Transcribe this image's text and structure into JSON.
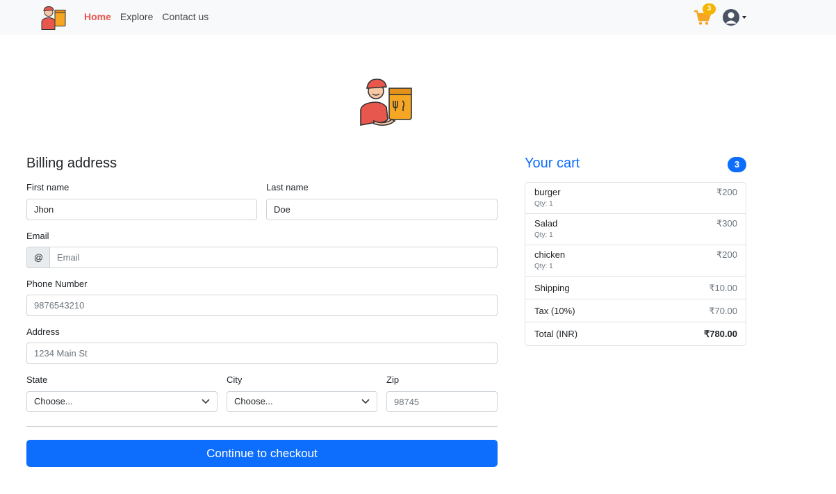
{
  "nav": {
    "logo_icon": "delivery-man-logo-icon",
    "links": [
      "Home",
      "Explore",
      "Contact us"
    ],
    "active_link": "Home",
    "cart_icon": "shopping-cart-icon",
    "cart_badge": "3",
    "avatar_icon": "user-avatar-icon",
    "colors": {
      "active": "#e8574d",
      "badge": "#f4b400",
      "bar": "#f8f9fa"
    }
  },
  "billing": {
    "title": "Billing address",
    "first_name": {
      "label": "First name",
      "value": "Jhon"
    },
    "last_name": {
      "label": "Last name",
      "value": "Doe"
    },
    "email": {
      "label": "Email",
      "prefix": "@",
      "placeholder": "Email"
    },
    "phone": {
      "label": "Phone Number",
      "placeholder": "9876543210"
    },
    "address": {
      "label": "Address",
      "placeholder": "1234 Main St"
    },
    "state": {
      "label": "State",
      "selected": "Choose..."
    },
    "city": {
      "label": "City",
      "selected": "Choose..."
    },
    "zip": {
      "label": "Zip",
      "placeholder": "98745"
    },
    "submit_label": "Continue to checkout",
    "colors": {
      "primary": "#0d6efd"
    }
  },
  "cart": {
    "title": "Your cart",
    "count": "3",
    "items": [
      {
        "name": "burger",
        "qty": "Qty: 1",
        "price": "₹200"
      },
      {
        "name": "Salad",
        "qty": "Qty: 1",
        "price": "₹300"
      },
      {
        "name": "chicken",
        "qty": "Qty: 1",
        "price": "₹200"
      }
    ],
    "shipping": {
      "label": "Shipping",
      "value": "₹10.00"
    },
    "tax": {
      "label": "Tax (10%)",
      "value": "₹70.00"
    },
    "total": {
      "label": "Total (INR)",
      "value": "₹780.00"
    }
  }
}
